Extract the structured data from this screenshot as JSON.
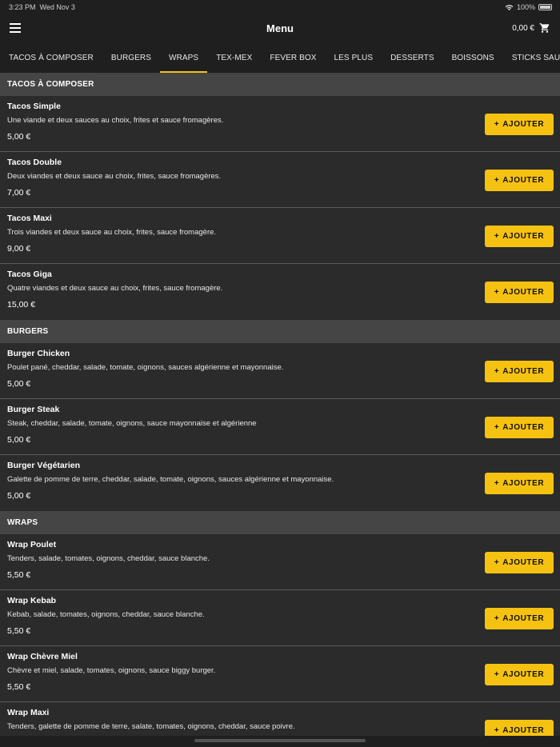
{
  "status_bar": {
    "time": "3:23 PM",
    "date": "Wed Nov 3",
    "battery": "100%"
  },
  "header": {
    "title": "Menu",
    "cart_total": "0,00 €"
  },
  "tabs": [
    {
      "label": "TACOS À COMPOSER"
    },
    {
      "label": "BURGERS"
    },
    {
      "label": "WRAPS",
      "active": true
    },
    {
      "label": "TEX-MEX"
    },
    {
      "label": "FEVER BOX"
    },
    {
      "label": "LES PLUS"
    },
    {
      "label": "DESSERTS"
    },
    {
      "label": "BOISSONS"
    },
    {
      "label": "STICKS SAUCES"
    }
  ],
  "sections": [
    {
      "title": "TACOS À COMPOSER",
      "items": [
        {
          "name": "Tacos Simple",
          "desc": "Une viande et deux sauces au choix, frites et sauce fromagères.",
          "price": "5,00 €"
        },
        {
          "name": "Tacos Double",
          "desc": "Deux viandes et deux sauce au choix, frites, sauce fromagères.",
          "price": "7,00 €"
        },
        {
          "name": "Tacos Maxi",
          "desc": "Trois viandes et deux sauce au choix, frites, sauce fromagère.",
          "price": "9,00 €"
        },
        {
          "name": "Tacos Giga",
          "desc": "Quatre viandes et deux sauce au choix, frites, sauce fromagère.",
          "price": "15,00 €"
        }
      ]
    },
    {
      "title": "BURGERS",
      "items": [
        {
          "name": "Burger Chicken",
          "desc": "Poulet pané, cheddar, salade, tomate, oignons, sauces algérienne et mayonnaise.",
          "price": "5,00 €"
        },
        {
          "name": "Burger Steak",
          "desc": "Steak, cheddar, salade, tomate, oignons, sauce mayonnaise et algérienne",
          "price": "5,00 €"
        },
        {
          "name": "Burger Végétarien",
          "desc": "Galette de pomme de terre, cheddar, salade, tomate, oignons, sauces algérienne et mayonnaise.",
          "price": "5,00 €"
        }
      ]
    },
    {
      "title": "WRAPS",
      "items": [
        {
          "name": "Wrap Poulet",
          "desc": "Tenders, salade, tomates, oignons, cheddar, sauce blanche.",
          "price": "5,50 €"
        },
        {
          "name": "Wrap Kebab",
          "desc": "Kebab, salade, tomates, oignons, cheddar, sauce blanche.",
          "price": "5,50 €"
        },
        {
          "name": "Wrap Chèvre Miel",
          "desc": "Chèvre et miel, salade, tomates, oignons, sauce biggy burger.",
          "price": "5,50 €"
        },
        {
          "name": "Wrap Maxi",
          "desc": "Tenders, galette de pomme de terre, salate, tomates, oignons, cheddar, sauce poivre.",
          "price": ""
        }
      ]
    }
  ],
  "add_button_label": "AJOUTER",
  "colors": {
    "accent": "#f6c211",
    "background": "#2b2b2b",
    "section": "#454545",
    "bar": "#1f1f1f"
  },
  "icons": {
    "menu": "hamburger-icon",
    "cart": "cart-icon",
    "wifi": "wifi-icon",
    "battery": "battery-icon",
    "add": "plus-icon"
  }
}
